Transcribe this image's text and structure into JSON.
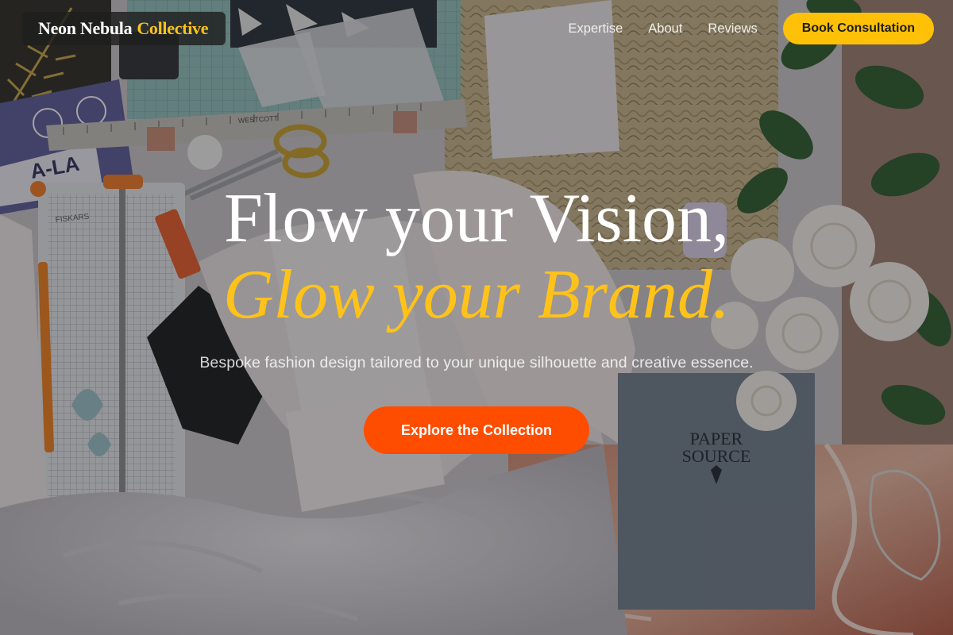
{
  "brand": {
    "name_white": "Neon Nebula",
    "name_accent": "Collective",
    "accent_color": "#ffc21a"
  },
  "nav": {
    "items": [
      {
        "label": "Expertise"
      },
      {
        "label": "About"
      },
      {
        "label": "Reviews"
      }
    ],
    "cta_label": "Book Consultation",
    "cta_color": "#ffc107"
  },
  "hero": {
    "line1": "Flow your Vision,",
    "line2": "Glow your Brand.",
    "subtitle": "Bespoke fashion design tailored to your unique silhouette and creative essence.",
    "button_label": "Explore the Collection",
    "button_color": "#ff4d00",
    "background": {
      "description_icons": [
        "cutting-mat",
        "ruler",
        "scissors",
        "paper-trimmer",
        "flowers",
        "fabric",
        "notebook",
        "envelope"
      ],
      "ruler_text": "WESTCOTT",
      "trimmer_text": "FISKARS",
      "notebook_text": [
        "PAPER",
        "SOURCE"
      ],
      "card_text": "A-LA"
    }
  }
}
